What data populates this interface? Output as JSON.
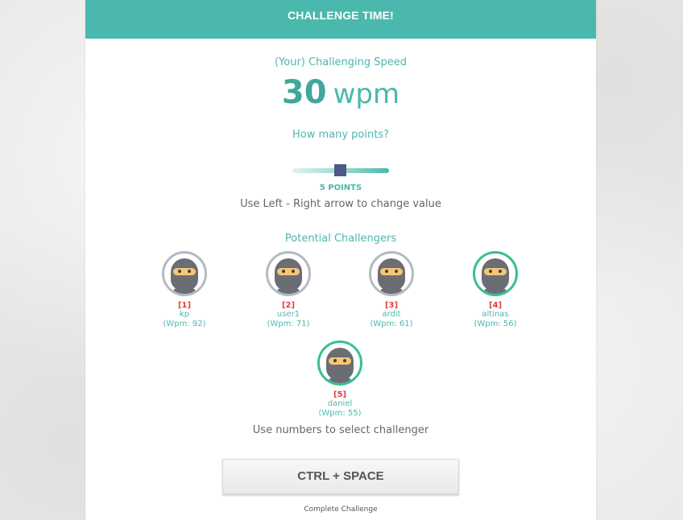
{
  "header": {
    "title": "CHALLENGE TIME!"
  },
  "speed": {
    "label": "(Your) Challenging Speed",
    "value": "30",
    "unit": "wpm"
  },
  "points": {
    "question": "How many points?",
    "value_label": "5 POINTS",
    "slider_fraction": 0.5,
    "hint": "Use Left - Right arrow to change value"
  },
  "challengers": {
    "title": "Potential Challengers",
    "hint": "Use numbers to select challenger",
    "items": [
      {
        "index": "[1]",
        "name": "kp",
        "wpm": "(Wpm: 92)",
        "active": false
      },
      {
        "index": "[2]",
        "name": "user1",
        "wpm": "(Wpm: 71)",
        "active": false
      },
      {
        "index": "[3]",
        "name": "ardit",
        "wpm": "(Wpm: 61)",
        "active": false
      },
      {
        "index": "[4]",
        "name": "altinas",
        "wpm": "(Wpm: 56)",
        "active": true
      },
      {
        "index": "[5]",
        "name": "daniel",
        "wpm": "(Wpm: 55)",
        "active": true
      }
    ]
  },
  "action": {
    "button_label": "CTRL + SPACE",
    "caption": "Complete Challenge"
  },
  "colors": {
    "accent": "#4bb8ad",
    "thumb": "#4d5a88",
    "index": "#e0403e",
    "active_ring": "#3bbf8e"
  }
}
